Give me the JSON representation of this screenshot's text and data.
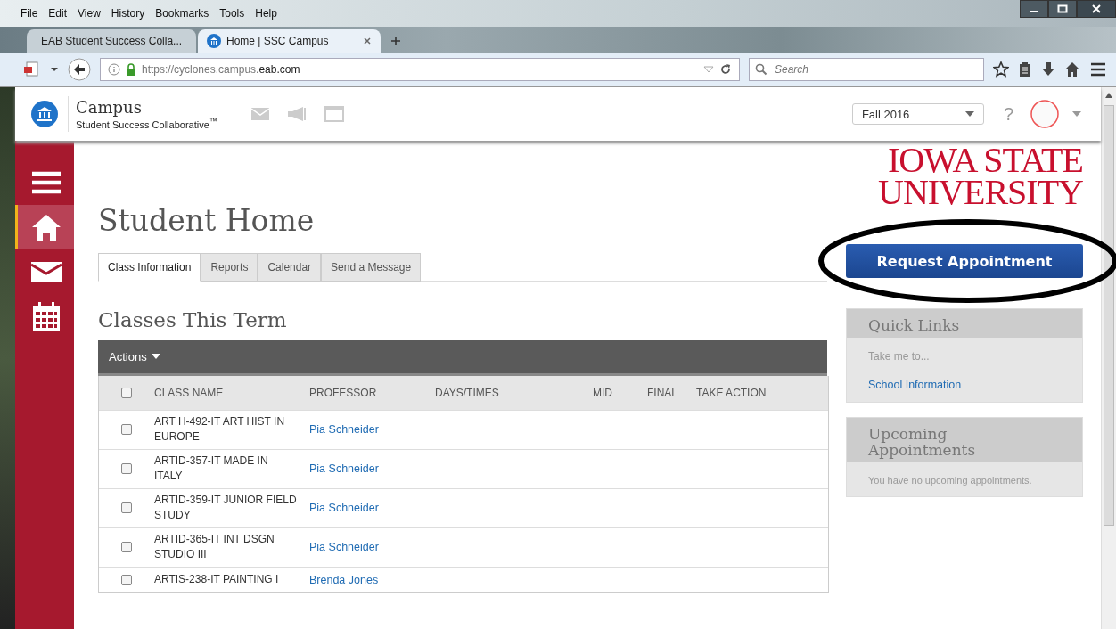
{
  "browser": {
    "menu": [
      "File",
      "Edit",
      "View",
      "History",
      "Bookmarks",
      "Tools",
      "Help"
    ],
    "tabs": [
      {
        "title": "EAB Student Success Colla...",
        "selected": false
      },
      {
        "title": "Home | SSC Campus",
        "selected": true
      }
    ],
    "url": {
      "base": "https://cyclones.campus.",
      "domain": "eab.com"
    },
    "search": {
      "placeholder": "Search"
    }
  },
  "header": {
    "app_name": "Campus",
    "subtitle": "Student Success Collaborative$^{™}$",
    "term": "Fall 2016",
    "help": "?"
  },
  "sidebar": {
    "items": [
      {
        "kind": "menu",
        "selected": false
      },
      {
        "kind": "home",
        "selected": true
      },
      {
        "kind": "mail",
        "selected": false
      },
      {
        "kind": "calendar",
        "selected": false
      }
    ]
  },
  "page": {
    "title": "Student Home",
    "tabs": [
      {
        "label": "Class Information",
        "selected": true
      },
      {
        "label": "Reports",
        "selected": false
      },
      {
        "label": "Calendar",
        "selected": false
      },
      {
        "label": "Send a Message",
        "selected": false
      }
    ],
    "section_title": "Classes This Term",
    "actions": "Actions",
    "table": {
      "header_checked": false,
      "columns": [
        "CLASS NAME",
        "PROFESSOR",
        "DAYS/TIMES",
        "MID",
        "FINAL",
        "TAKE ACTION"
      ],
      "rows": [
        {
          "class_name": "ART H-492-IT ART HIST IN EUROPE",
          "professor": "Pia Schneider",
          "checked": false
        },
        {
          "class_name": "ARTID-357-IT MADE IN ITALY",
          "professor": "Pia Schneider",
          "checked": false
        },
        {
          "class_name": "ARTID-359-IT JUNIOR FIELD STUDY",
          "professor": "Pia Schneider",
          "checked": false
        },
        {
          "class_name": "ARTID-365-IT INT DSGN STUDIO III",
          "professor": "Pia Schneider",
          "checked": false
        },
        {
          "class_name": "ARTIS-238-IT PAINTING I",
          "professor": "Brenda Jones",
          "checked": false
        }
      ]
    }
  },
  "aside": {
    "logo": [
      "IOWA STATE",
      "UNIVERSITY"
    ],
    "request_button": "Request Appointment",
    "quick_links": {
      "title": "Quick Links",
      "intro": "Take me to...",
      "links": [
        "School Information"
      ]
    },
    "upcoming": {
      "title": "Upcoming Appointments",
      "empty": "You have no upcoming appointments."
    }
  }
}
